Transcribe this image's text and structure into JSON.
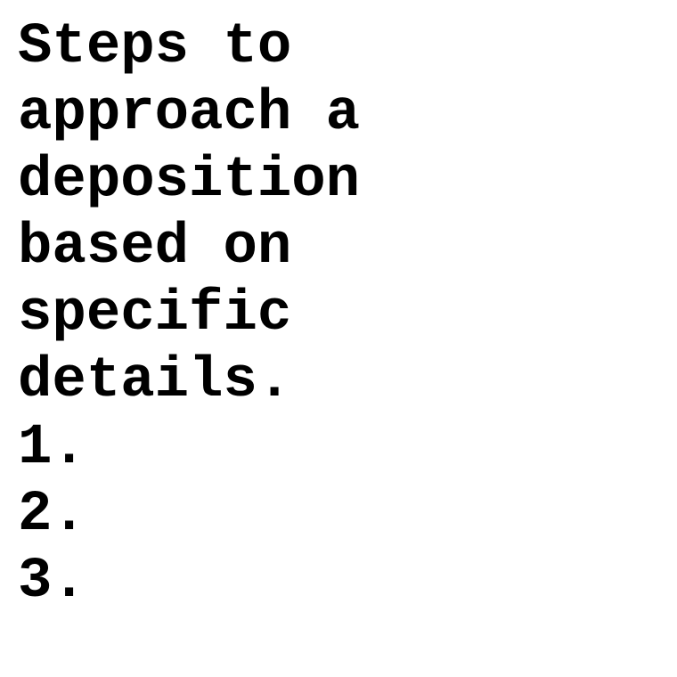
{
  "document": {
    "title_lines": [
      "Steps to",
      "approach a",
      "deposition",
      "based on",
      "specific",
      "details."
    ],
    "list_items": [
      "1.",
      "2.",
      "3."
    ]
  }
}
